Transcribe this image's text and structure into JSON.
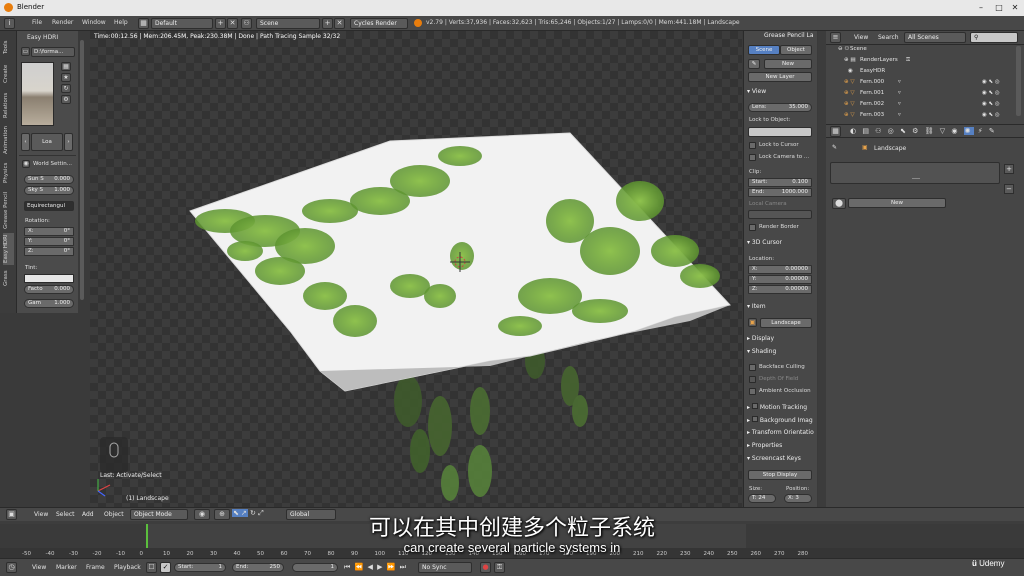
{
  "window": {
    "title": "Blender"
  },
  "menu": {
    "items": [
      "File",
      "Render",
      "Window",
      "Help"
    ],
    "layout": "Default",
    "scene": "Scene",
    "engine": "Cycles Render",
    "stats": "v2.79 | Verts:37,936 | Faces:32,623 | Tris:65,246 | Objects:1/27 | Lamps:0/0 | Mem:441.18M | Landscape"
  },
  "left_tabs": [
    "Tools",
    "Create",
    "Relations",
    "Animation",
    "Physics",
    "Grease Pencil",
    "Easy HDRI",
    "Grass"
  ],
  "shelf": {
    "title": "Easy HDRI",
    "dir_value": "D:\\forma...",
    "load_label": "Loa",
    "world_settings": "World Settin...",
    "sun_label": "Sun S",
    "sun_value": "0.000",
    "sky_label": "Sky S",
    "sky_value": "1.000",
    "projection": "Equirectangul",
    "rotation_label": "Rotation:",
    "rot_x_label": "X:",
    "rot_x": "0°",
    "rot_y_label": "Y:",
    "rot_y": "0°",
    "rot_z_label": "Z:",
    "rot_z": "0°",
    "tint_label": "Tint:",
    "factor_label": "Facto",
    "factor_value": "0.000",
    "gamma_label": "Gam",
    "gamma_value": "1.000"
  },
  "viewport": {
    "header": "Time:00:12.56 | Mem:206.45M, Peak:230.38M | Done | Path Tracing Sample 32/32",
    "last_op": "Last: Activate/Select",
    "object_label": "(1) Landscape"
  },
  "npanel": {
    "grease_pencil": "Grease Pencil La",
    "scene_tab": "Scene",
    "object_tab": "Object",
    "new_label": "New",
    "new_layer": "New Layer",
    "view_header": "View",
    "lens_label": "Lens:",
    "lens_value": "35.000",
    "lock_to_object": "Lock to Object:",
    "lock_to_cursor": "Lock to Cursor",
    "lock_camera": "Lock Camera to ...",
    "clip_label": "Clip:",
    "clip_start_label": "Start:",
    "clip_start": "0.100",
    "clip_end_label": "End:",
    "clip_end": "1000.000",
    "local_camera": "Local Camera",
    "render_border": "Render Border",
    "cursor_header": "3D Cursor",
    "location_label": "Location:",
    "cx_label": "X:",
    "cx": "0.00000",
    "cy_label": "Y:",
    "cy": "0.00000",
    "cz_label": "Z:",
    "cz": "0.00000",
    "item_header": "Item",
    "item_name": "Landscape",
    "display_header": "Display",
    "shading_header": "Shading",
    "backface": "Backface Culling",
    "depth_of_field": "Depth Of Field",
    "ambient_occlusion": "Ambient Occlusion",
    "motion_tracking": "Motion Tracking",
    "background_images": "Background Imag",
    "transform_orient": "Transform Orientatio",
    "properties": "Properties",
    "screencast_keys": "Screencast Keys",
    "stop_display": "Stop Display",
    "size_label": "Size:",
    "position_label": "Position:",
    "size_value": "T: 24",
    "position_value": "X: 3"
  },
  "outliner": {
    "view": "View",
    "search": "Search",
    "filter": "All Scenes",
    "rows": [
      "Scene",
      "RenderLayers",
      "EasyHDR",
      "Fern.000",
      "Fern.001",
      "Fern.002",
      "Fern.003"
    ]
  },
  "properties_editor": {
    "breadcrumb": "Landscape",
    "new_label": "New"
  },
  "view3d_header": {
    "view": "View",
    "select": "Select",
    "add": "Add",
    "object": "Object",
    "mode": "Object Mode",
    "orientation": "Global"
  },
  "timeline": {
    "ticks": [
      "-50",
      "-40",
      "-30",
      "-20",
      "-10",
      "0",
      "10",
      "20",
      "30",
      "40",
      "50",
      "60",
      "70",
      "80",
      "90",
      "100",
      "110",
      "120",
      "130",
      "140",
      "150",
      "160",
      "170",
      "180",
      "190",
      "200",
      "210",
      "220",
      "230",
      "240",
      "250",
      "260",
      "270",
      "280"
    ],
    "view": "View",
    "marker": "Marker",
    "frame": "Frame",
    "playback": "Playback",
    "start_label": "Start:",
    "start_value": "1",
    "end_label": "End:",
    "end_value": "250",
    "current_frame": "1",
    "sync": "No Sync"
  },
  "subtitle": {
    "cn": "可以在其中创建多个粒子系统",
    "en": "can create several particle systems in"
  },
  "watermark": "Udemy",
  "colors": {
    "accent": "#5680c2",
    "timeline_playhead": "#5bbf3d",
    "landscape": "#f0f0f0",
    "foliage": "#6ea83a"
  }
}
